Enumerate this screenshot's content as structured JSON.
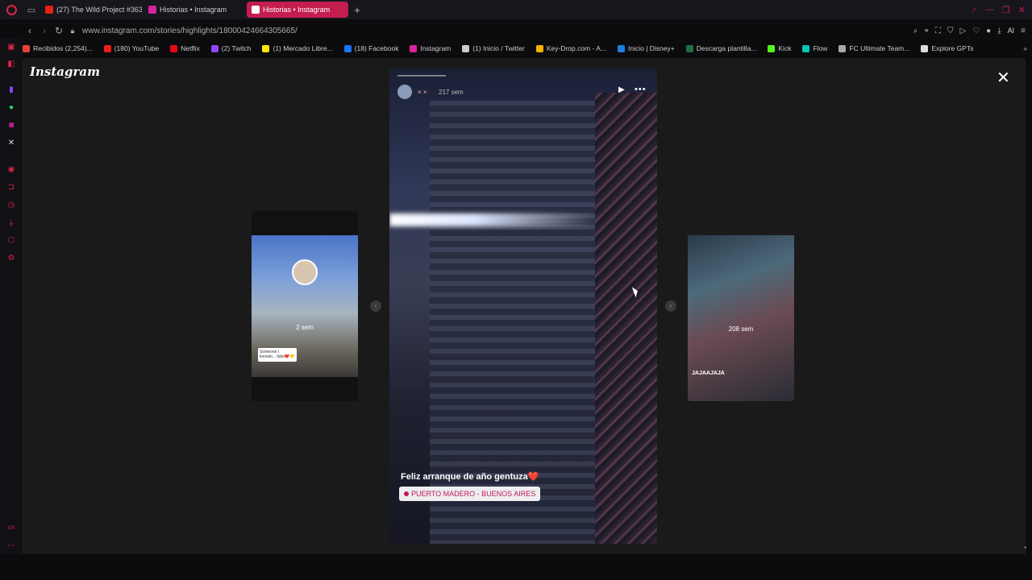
{
  "tabs": [
    {
      "label": "(27) The Wild Project #363",
      "favicon_color": "#e62117",
      "active": false
    },
    {
      "label": "Historias • Instagram",
      "favicon_color": "#d6249f",
      "active": false
    },
    {
      "label": "Historias • Instagram",
      "favicon_color": "#d6249f",
      "active": true
    }
  ],
  "address": {
    "url": "www.instagram.com/stories/highlights/18000424664305665/",
    "ai_label": "AI"
  },
  "bookmarks": [
    {
      "label": "Recibidos (2,254)...",
      "color": "#ea4335"
    },
    {
      "label": "(180) YouTube",
      "color": "#e62117"
    },
    {
      "label": "Netflix",
      "color": "#e50914"
    },
    {
      "label": "(2) Twitch",
      "color": "#9146ff"
    },
    {
      "label": "(1) Mercado Libre...",
      "color": "#ffe600"
    },
    {
      "label": "(18) Facebook",
      "color": "#1877f2"
    },
    {
      "label": "Instagram",
      "color": "#d6249f"
    },
    {
      "label": "(1) Inicio / Twitter",
      "color": "#cccccc"
    },
    {
      "label": "Key-Drop.com - A...",
      "color": "#f5b400"
    },
    {
      "label": "Inicio | Disney+",
      "color": "#1f80e0"
    },
    {
      "label": "Descarga plantilla...",
      "color": "#1e7145"
    },
    {
      "label": "Kick",
      "color": "#53fc18"
    },
    {
      "label": "Flow",
      "color": "#00c8b4"
    },
    {
      "label": "FC Ultimate Team...",
      "color": "#aaaaaa"
    },
    {
      "label": "Explore GPTs",
      "color": "#dddddd"
    }
  ],
  "page": {
    "brand": "Instagram",
    "story": {
      "username": "× ×",
      "time": "217 sem",
      "caption": "Feliz arranque de año gentuza❤️",
      "location": "PUERTO MADERO - BUENOS AIRES"
    },
    "prev_story": {
      "time": "2 sem",
      "note": "Someone i knowto... fabs❤️💛"
    },
    "next_story": {
      "time": "208 sem",
      "caption": "JAJAAJAJA"
    }
  },
  "sidebar_footer": "GX"
}
